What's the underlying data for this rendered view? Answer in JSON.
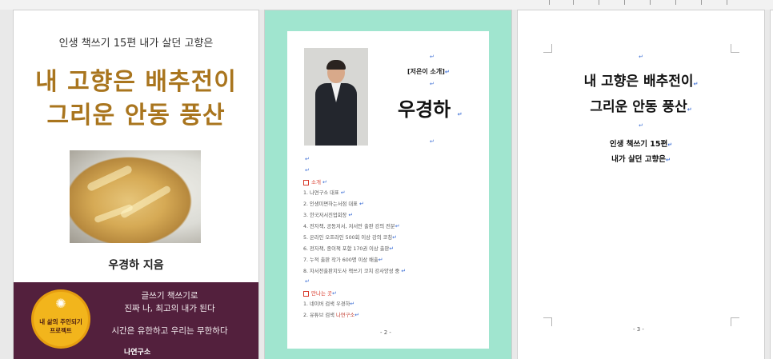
{
  "page1": {
    "subtitle": "인생 책쓰기 15편 내가 살던 고향은",
    "title_line1": "내 고향은 배추전이",
    "title_line2": "그리운 안동 풍산",
    "author": "우경하 지음",
    "band_line1": "글쓰기 책쓰기로",
    "band_line2": "진짜 나, 최고의 내가 된다",
    "band_line3": "시간은 유한하고 우리는 무한하다",
    "seal_line1": "내 삶의 주인되기",
    "seal_line2": "프로젝트",
    "publisher": "나연구소",
    "colors": {
      "title": "#a9751e",
      "band": "#53203d",
      "seal": "#f2b51c"
    }
  },
  "page2": {
    "intro_label": "[저은이 소개]",
    "name": "우경하",
    "section1": "소개",
    "items": [
      "1. 나연구소 대표",
      "2. 인생미면하는서점 대표",
      "3. 한국저서진업회장",
      "4. 전자책, 공동저서, 저서만 출판 강의 전분",
      "5. 온라인 오프라인 500회 이상 강의 코칭",
      "6. 전자책, 종이책 포함 170권 이상 출판",
      "7. 누적 출판 작가 600명 이상 배출",
      "8. 자서전출판지도사 책쓰기 코치 강사양성 중"
    ],
    "section2": "만나는 곳",
    "meet_items": [
      "1. 네이버 검색 우경하",
      "2. 유튜브 검색"
    ],
    "meet_highlight": "나연구소",
    "page_number": "- 2 -",
    "colors": {
      "background": "#a0e5cf",
      "section": "#d83a2b",
      "return_mark": "#3d6fd6"
    }
  },
  "page3": {
    "title_line1": "내 고향은 배추전이",
    "title_line2": "그리운 안동 풍산",
    "sub_line1": "인생 책쓰기 15편",
    "sub_line2": "내가 살던 고향은",
    "page_number": "- 3 -"
  },
  "return_mark": "↵"
}
